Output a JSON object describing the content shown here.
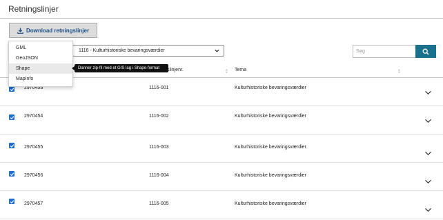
{
  "page": {
    "title": "Retningslinjer"
  },
  "toolbar": {
    "download_label": "Download retningslinjer",
    "download_icon": "download-icon"
  },
  "filter": {
    "selected": "1116 - Kulturhistoriske bevaringsværdier"
  },
  "search": {
    "placeholder": "Søg",
    "icon": "search-icon"
  },
  "table": {
    "columns": [
      "Retningslinjenr.",
      "Tema"
    ],
    "rows": [
      {
        "id": "2970453",
        "nr": "1116-001",
        "tema": "Kulturhistoriske bevaringsværdier",
        "checked": true
      },
      {
        "id": "2970454",
        "nr": "1116-002",
        "tema": "Kulturhistoriske bevaringsværdier",
        "checked": true
      },
      {
        "id": "2970455",
        "nr": "1116-003",
        "tema": "Kulturhistoriske bevaringsværdier",
        "checked": true
      },
      {
        "id": "2970456",
        "nr": "1116-004",
        "tema": "Kulturhistoriske bevaringsværdier",
        "checked": true
      },
      {
        "id": "2970457",
        "nr": "1116-005",
        "tema": "Kulturhistoriske bevaringsværdier",
        "checked": true
      }
    ]
  },
  "download_menu": {
    "items": [
      "GML",
      "GeoJSON",
      "Shape",
      "MapInfo"
    ],
    "hovered": "Shape",
    "tooltip": "Danner zip-fil med et GIS lag i Shape-format"
  },
  "colors": {
    "accent": "#19718e",
    "link": "#1b4f86",
    "checkbox": "#1f6fd2"
  }
}
